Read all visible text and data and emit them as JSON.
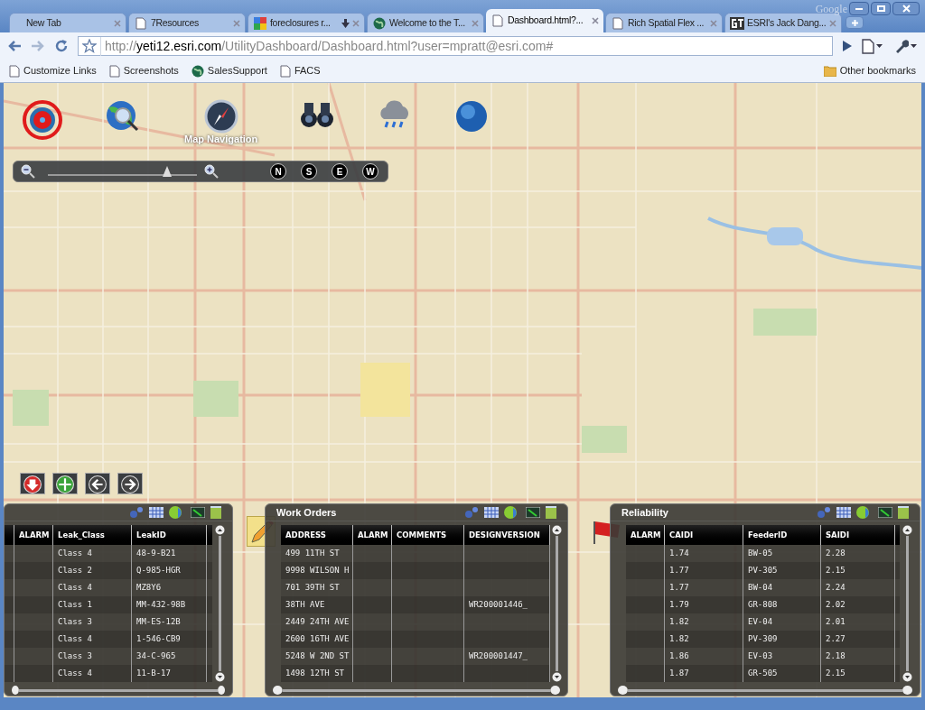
{
  "browser": {
    "brand": "Google",
    "tabs": [
      {
        "title": "New Tab",
        "selected": false
      },
      {
        "title": "7Resources",
        "selected": false
      },
      {
        "title": "foreclosures r...",
        "selected": false
      },
      {
        "title": "Welcome to the T...",
        "selected": false
      },
      {
        "title": "Dashboard.html?...",
        "selected": true
      },
      {
        "title": "Rich Spatial Flex ...",
        "selected": false
      },
      {
        "title": "ESRI's Jack Dang...",
        "selected": false
      }
    ],
    "url": {
      "scheme": "http://",
      "host": "yeti12.esri.com",
      "path": "/UtilityDashboard/Dashboard.html?user=mpratt@esri.com#"
    },
    "bookmarks": [
      "Customize Links",
      "Screenshots",
      "SalesSupport",
      "FACS"
    ],
    "other_bookmarks": "Other bookmarks"
  },
  "map": {
    "navigation_label": "Map Navigation",
    "zoom": {
      "level": 0.8
    },
    "directions": [
      "N",
      "S",
      "E",
      "W"
    ]
  },
  "panels": [
    {
      "columns": [
        "ALARM",
        "Leak_Class",
        "LeakID"
      ],
      "rows": [
        [
          null,
          "Class 4",
          "48-9-B21"
        ],
        [
          null,
          "Class 2",
          "Q-985-HGR"
        ],
        [
          null,
          "Class 4",
          "MZ8Y6"
        ],
        [
          null,
          "Class 1",
          "MM-432-98B"
        ],
        [
          null,
          "Class 3",
          "MM-ES-12B"
        ],
        [
          null,
          "Class 4",
          "1-546-CB9"
        ],
        [
          null,
          "Class 3",
          "34-C-965"
        ],
        [
          null,
          "Class 4",
          "11-B-17"
        ]
      ]
    },
    {
      "title": "Work Orders",
      "columns": [
        "ADDRESS",
        "ALARM",
        "COMMENTS",
        "DESIGNVERSION"
      ],
      "rows": [
        [
          "499 11TH ST",
          null,
          null,
          null
        ],
        [
          "9998 WILSON H",
          null,
          null,
          null
        ],
        [
          "701 39TH ST",
          null,
          null,
          null
        ],
        [
          "38TH AVE",
          null,
          null,
          "WR200001446_"
        ],
        [
          "2449 24TH AVE",
          null,
          null,
          null
        ],
        [
          "2600 16TH AVE",
          null,
          null,
          null
        ],
        [
          "5248 W 2ND ST",
          null,
          null,
          "WR200001447_"
        ],
        [
          "1498 12TH ST",
          null,
          null,
          null
        ]
      ]
    },
    {
      "title": "Reliability",
      "columns": [
        "ALARM",
        "CAIDI",
        "FeederID",
        "SAIDI"
      ],
      "rows": [
        [
          null,
          "1.74",
          "BW-05",
          "2.28"
        ],
        [
          null,
          "1.77",
          "PV-305",
          "2.15"
        ],
        [
          null,
          "1.77",
          "BW-04",
          "2.24"
        ],
        [
          null,
          "1.79",
          "GR-808",
          "2.02"
        ],
        [
          null,
          "1.82",
          "EV-04",
          "2.01"
        ],
        [
          null,
          "1.82",
          "PV-309",
          "2.27"
        ],
        [
          null,
          "1.86",
          "EV-03",
          "2.18"
        ],
        [
          null,
          "1.87",
          "GR-505",
          "2.15"
        ]
      ]
    }
  ]
}
